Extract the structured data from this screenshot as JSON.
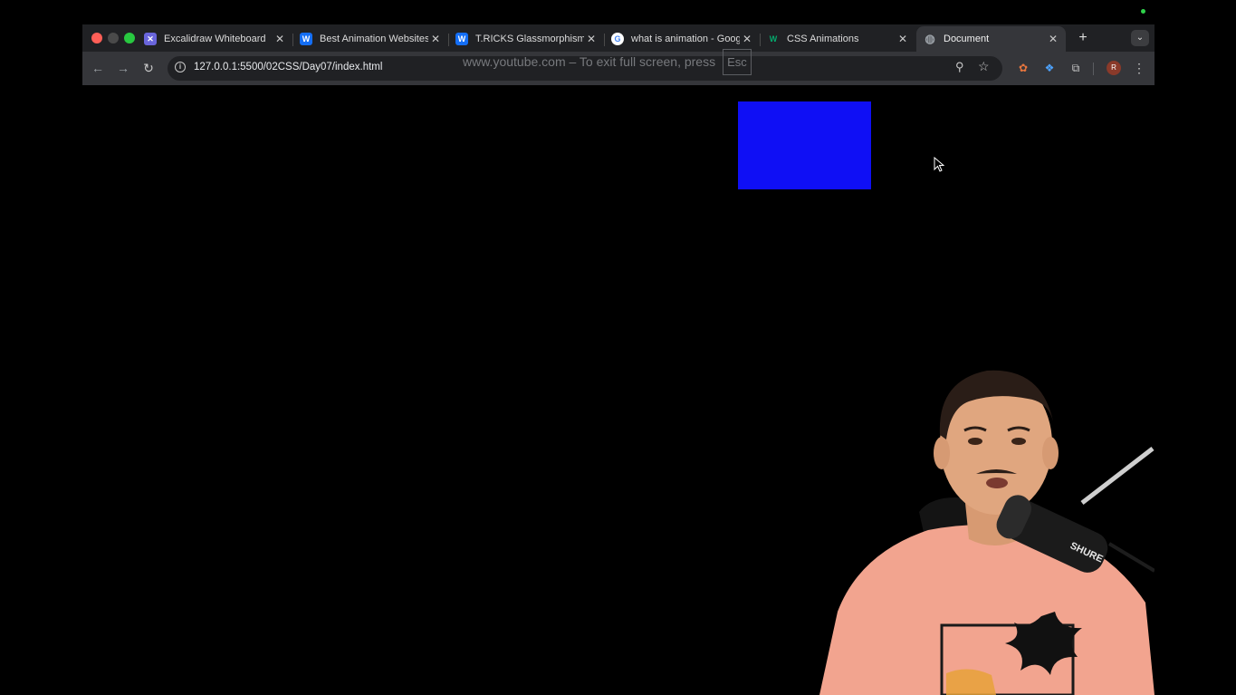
{
  "browser": {
    "tabs": [
      {
        "title": "Excalidraw Whiteboard",
        "favicon": "excalidraw-icon",
        "color": "#6965db",
        "glyph": "✕",
        "active": false
      },
      {
        "title": "Best Animation Websites |",
        "favicon": "webflow-icon",
        "color": "#146ef5",
        "glyph": "W",
        "active": false
      },
      {
        "title": "T.RICKS Glassmorphism -",
        "favicon": "webflow-icon",
        "color": "#146ef5",
        "glyph": "W",
        "active": false
      },
      {
        "title": "what is animation - Google",
        "favicon": "google-icon",
        "color": "#ffffff",
        "glyph": "G",
        "active": false
      },
      {
        "title": "CSS Animations",
        "favicon": "w3schools-icon",
        "color": "#04aa6d",
        "glyph": "W",
        "active": false
      },
      {
        "title": "Document",
        "favicon": "globe-icon",
        "color": "#9aa0a6",
        "glyph": "◍",
        "active": true
      }
    ],
    "new_tab_symbol": "+",
    "tab_search_symbol": "⌄",
    "close_symbol": "✕",
    "back_symbol": "←",
    "forward_symbol": "→",
    "reload_symbol": "↻",
    "url": "127.0.0.1:5500/02CSS/Day07/index.html",
    "info_symbol": "i",
    "zoom_symbol": "⚲",
    "star_symbol": "☆",
    "fullscreen_notice": "www.youtube.com – To exit full screen, press",
    "fullscreen_key": "Esc",
    "extensions": [
      {
        "name": "extension-orange-icon",
        "glyph": "✿"
      },
      {
        "name": "extension-blue-icon",
        "glyph": "❖"
      },
      {
        "name": "extensions-puzzle-icon",
        "glyph": "⧉"
      }
    ],
    "profile_initial": "R",
    "menu_symbol": "⋮"
  },
  "page": {
    "box_color": "#0f0ff5"
  },
  "webcam": {
    "shirt_text": "SHURE"
  }
}
